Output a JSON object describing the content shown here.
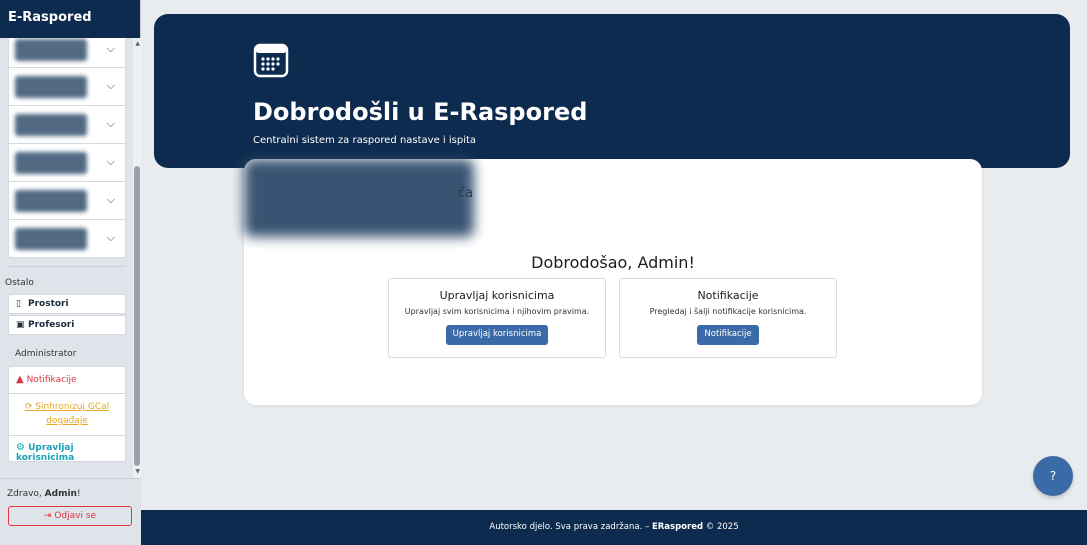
{
  "sidebar": {
    "brand": "E-Raspored",
    "sections": {
      "other_label": "Ostalo",
      "admin_label": "Administrator"
    },
    "nav": {
      "rooms": "Prostori",
      "professors": "Profesori"
    },
    "admin": {
      "notifications": "Notifikacije",
      "sync_gcal": "Sinhronizuj GCal događaje",
      "manage_users": "Upravljaj korisnicima"
    },
    "user": {
      "greet_prefix": "Zdravo, ",
      "name": "Admin",
      "greet_suffix": "!",
      "logout": "Odjavi se"
    }
  },
  "hero": {
    "title": "Dobrodošli u E-Raspored",
    "subtitle": "Centralni sistem za raspored nastave i ispita"
  },
  "card": {
    "fragment": "ča",
    "welcome": "Dobrodošao, Admin!",
    "options": [
      {
        "title": "Upravljaj korisnicima",
        "desc": "Upravljaj svim korisnicima i njihovim pravima.",
        "button": "Upravljaj korisnicima"
      },
      {
        "title": "Notifikacije",
        "desc": "Pregledaj i šalji notifikacije korisnicima.",
        "button": "Notifikacije"
      }
    ]
  },
  "footer": {
    "text": "Autorsko djelo. Sva prava zadržana. – ",
    "brand": "ERaspored",
    "year": " © 2025"
  },
  "help": {
    "label": "?"
  },
  "colors": {
    "navy": "#0d2b4e",
    "accent_blue": "#3b6aa8",
    "danger": "#dc3545",
    "warning": "#f0ad4e",
    "info": "#17a2b8"
  }
}
